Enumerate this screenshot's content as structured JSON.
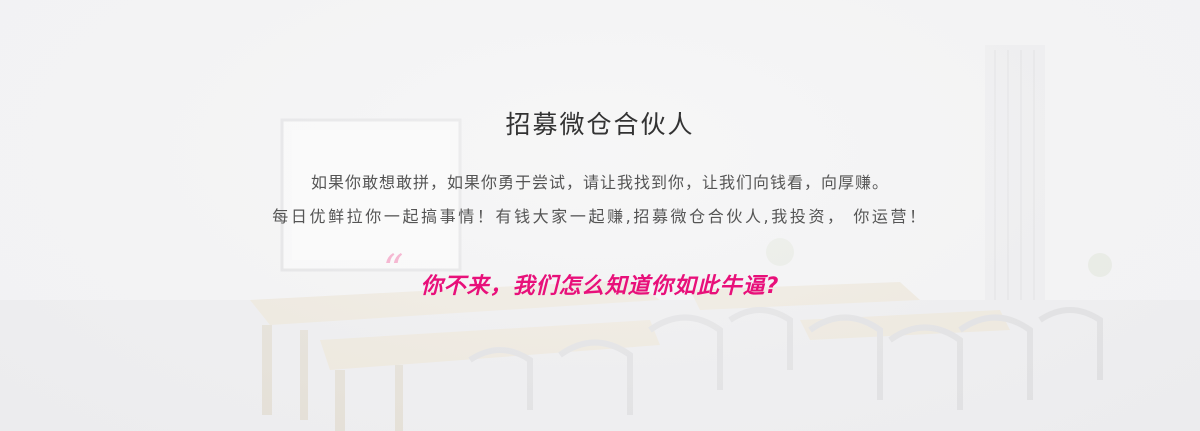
{
  "banner": {
    "title": "招募微仓合伙人",
    "line1": "如果你敢想敢拼，如果你勇于尝试，请让我找到你，让我们向钱看，向厚赚。",
    "line2": "每日优鲜拉你一起搞事情！有钱大家一起赚,招募微仓合伙人,我投资， 你运营！",
    "quote_mark": "“",
    "slogan": "你不来，我们怎么知道你如此牛逼?"
  },
  "colors": {
    "title": "#333333",
    "body": "#555555",
    "accent": "#e8107a",
    "background": "#f3f3f4"
  }
}
